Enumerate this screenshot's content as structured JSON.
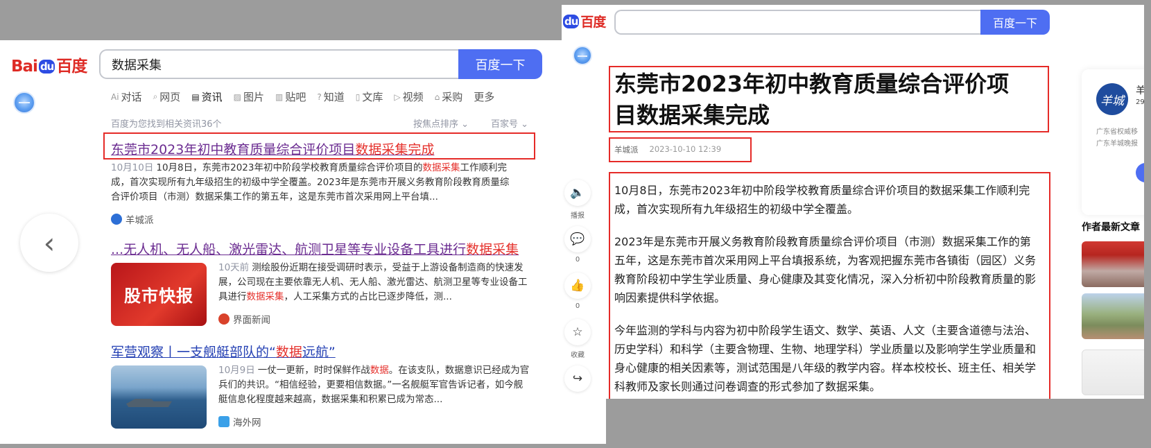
{
  "left": {
    "logo": {
      "part1": "Bai",
      "part2": "du",
      "part3": "百度"
    },
    "search_query": "数据采集",
    "search_button": "百度一下",
    "tabs": [
      {
        "icon": "Ai",
        "label": "对话"
      },
      {
        "icon": "⌕",
        "label": "网页"
      },
      {
        "icon": "▤",
        "label": "资讯"
      },
      {
        "icon": "▨",
        "label": "图片"
      },
      {
        "icon": "▥",
        "label": "贴吧"
      },
      {
        "icon": "?",
        "label": "知道"
      },
      {
        "icon": "▯",
        "label": "文库"
      },
      {
        "icon": "▷",
        "label": "视频"
      },
      {
        "icon": "⌂",
        "label": "采购"
      },
      {
        "icon": "",
        "label": "更多"
      }
    ],
    "result_count": "百度为您找到相关资讯36个",
    "sort_focus": "按焦点排序",
    "sort_baijia": "百家号",
    "results": [
      {
        "title_plain": "东莞市2023年初中教育质量综合评价项目",
        "title_hl": "数据采集完成",
        "date": "10月10日",
        "abs_1": "10月8日，东莞市2023年初中阶段学校教育质量综合评价项目的",
        "abs_hl": "数据采集",
        "abs_2": "工作顺利完成，首次实现所有九年级招生的初级中学全覆盖。2023年是东莞市开展义务教育阶段教育质量综合评价项目（市测）数据采集工作的第五年，这是东莞市首次采用网上平台填...",
        "source": "羊城派"
      },
      {
        "title_plain": "...无人机、无人船、激光雷达、航测卫星等专业设备工具进行",
        "title_hl": "数据采集",
        "date": "10天前",
        "abs_1": "测绘股份近期在接受调研时表示，受益于上游设备制造商的快速发展，公司现在主要依靠无人机、无人船、激光雷达、航测卫星等专业设备工具进行",
        "abs_hl": "数据采集",
        "abs_2": "，人工采集方式的占比已逐步降低，测...",
        "source": "界面新闻",
        "thumb_text": "股市快报"
      },
      {
        "title_plain": "军营观察丨一支舰艇部队的“",
        "title_hl": "数据",
        "title_end": "远航”",
        "date": "10月9日",
        "abs_1": "一仗一更新，时时保鲜作战",
        "abs_hl": "数据",
        "abs_2": "。在该支队，数据意识已经成为官兵们的共识。“相信经验，更要相信数据。”一名舰艇军官告诉记者，如今舰艇信息化程度越来越高，数据采集和积累已成为常态...",
        "source": "海外网"
      }
    ]
  },
  "right": {
    "logo": {
      "part2": "du",
      "part3": "百度"
    },
    "search_button": "百度一下",
    "article_title": "东莞市2023年初中教育质量综合评价项目数据采集完成",
    "author": "羊城派",
    "time": "2023-10-10 12:39",
    "paragraphs": [
      "10月8日，东莞市2023年初中阶段学校教育质量综合评价项目的数据采集工作顺利完成，首次实现所有九年级招生的初级中学全覆盖。",
      "2023年是东莞市开展义务教育阶段教育质量综合评价项目（市测）数据采集工作的第五年，这是东莞市首次采用网上平台填报系统，为客观把握东莞市各镇街（园区）义务教育阶段初中学生学业质量、身心健康及其变化情况，深入分析初中阶段教育质量的影响因素提供科学依据。",
      "今年监测的学科与内容为初中阶段学生语文、数学、英语、人文（主要含道德与法治、历史学科）和科学（主要含物理、生物、地理学科）学业质量以及影响学生学业质量和身心健康的相关因素等，测试范围是八年级的教学内容。样本校校长、班主任、相关学科教师及家长则通过问卷调查的形式参加了数据采集。"
    ],
    "actions": [
      {
        "icon": "🔈",
        "label": "播报"
      },
      {
        "icon": "💬",
        "label": "0"
      },
      {
        "icon": "👍",
        "label": "0"
      },
      {
        "icon": "☆",
        "label": "收藏"
      },
      {
        "icon": "↪",
        "label": ""
      }
    ],
    "author_card": {
      "logo_text": "羊城",
      "name": "羊",
      "fans": "29",
      "desc_1": "广东省权威移",
      "desc_2": "广东羊城晚报"
    },
    "latest_heading": "作者最新文章"
  }
}
